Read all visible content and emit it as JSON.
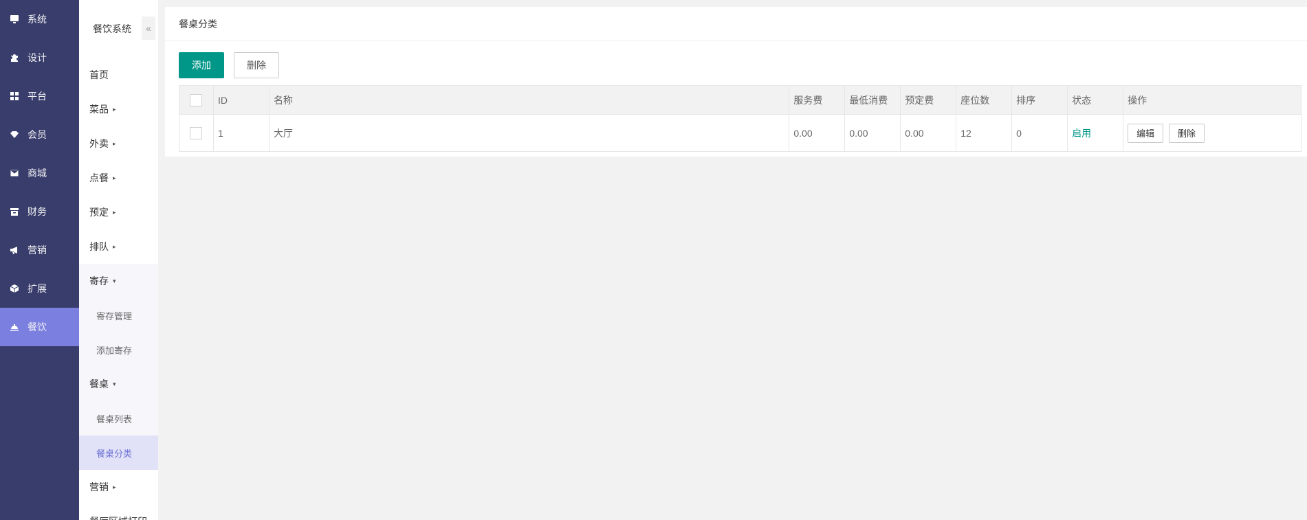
{
  "primary_nav": [
    {
      "label": "系统",
      "icon": "monitor-icon"
    },
    {
      "label": "设计",
      "icon": "puzzle-icon"
    },
    {
      "label": "平台",
      "icon": "grid-icon"
    },
    {
      "label": "会员",
      "icon": "diamond-icon"
    },
    {
      "label": "商城",
      "icon": "mail-icon"
    },
    {
      "label": "财务",
      "icon": "archive-icon"
    },
    {
      "label": "营销",
      "icon": "megaphone-icon"
    },
    {
      "label": "扩展",
      "icon": "cube-icon"
    },
    {
      "label": "餐饮",
      "icon": "cloche-icon",
      "active": true
    }
  ],
  "secondary_nav": {
    "title": "餐饮系统",
    "collapse_glyph": "«",
    "items": [
      {
        "label": "首页"
      },
      {
        "label": "菜品",
        "caret": "▸"
      },
      {
        "label": "外卖",
        "caret": "▸"
      },
      {
        "label": "点餐",
        "caret": "▸"
      },
      {
        "label": "预定",
        "caret": "▸"
      },
      {
        "label": "排队",
        "caret": "▸"
      }
    ],
    "groups": [
      {
        "label": "寄存",
        "caret": "▾",
        "children": [
          "寄存管理",
          "添加寄存"
        ]
      },
      {
        "label": "餐桌",
        "caret": "▾",
        "children": [
          "餐桌列表",
          "餐桌分类"
        ]
      }
    ],
    "after_items": [
      {
        "label": "营销",
        "caret": "▸"
      },
      {
        "label": "餐厅区域打印"
      }
    ]
  },
  "main": {
    "title": "餐桌分类",
    "add_label": "添加",
    "delete_label": "删除",
    "table": {
      "headers": [
        "ID",
        "名称",
        "服务费",
        "最低消费",
        "预定费",
        "座位数",
        "排序",
        "状态",
        "操作"
      ],
      "rows": [
        {
          "id": "1",
          "name": "大厅",
          "service_fee": "0.00",
          "min_spend": "0.00",
          "booking_fee": "0.00",
          "seats": "12",
          "sort": "0",
          "status": "启用",
          "edit_label": "编辑",
          "delete_label": "删除"
        }
      ]
    }
  },
  "colors": {
    "primary_sidebar": "#393d6b",
    "active_primary": "#7b7fe0",
    "accent_green": "#009688",
    "active_sub_bg": "#e1e2f7",
    "active_sub_text": "#6a6fd4"
  }
}
